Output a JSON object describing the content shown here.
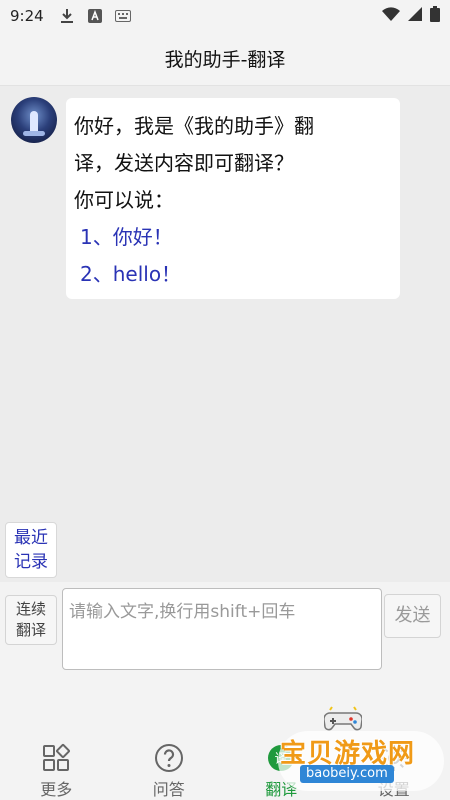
{
  "status_bar": {
    "time": "9:24",
    "left_icons": [
      "download-icon",
      "app-a-icon",
      "keyboard-icon"
    ],
    "right_icons": [
      "wifi-icon",
      "signal-icon",
      "battery-icon"
    ]
  },
  "header": {
    "title": "我的助手-翻译"
  },
  "chat": {
    "messages": [
      {
        "sender": "assistant",
        "lines": [
          "你好，我是《我的助手》翻",
          "译，发送内容即可翻译？",
          "你可以说："
        ],
        "options": [
          "1、你好！",
          "2、hello！"
        ]
      }
    ]
  },
  "recent": {
    "label_line1": "最近",
    "label_line2": "记录"
  },
  "input": {
    "continuous_line1": "连续",
    "continuous_line2": "翻译",
    "placeholder": "请输入文字,换行用shift+回车",
    "value": "",
    "send_label": "发送"
  },
  "tabs": [
    {
      "label": "更多",
      "icon": "grid-icon",
      "active": false
    },
    {
      "label": "问答",
      "icon": "question-icon",
      "active": false
    },
    {
      "label": "翻译",
      "icon": "translate-icon",
      "active": true
    },
    {
      "label": "设置",
      "icon": "settings-icon",
      "active": false
    }
  ],
  "watermark": {
    "main": "宝贝游戏网",
    "sub": "baobeiy.com"
  },
  "colors": {
    "accent_blue": "#2a33b5",
    "active_green": "#1f9a3d",
    "background": "#ececec"
  }
}
